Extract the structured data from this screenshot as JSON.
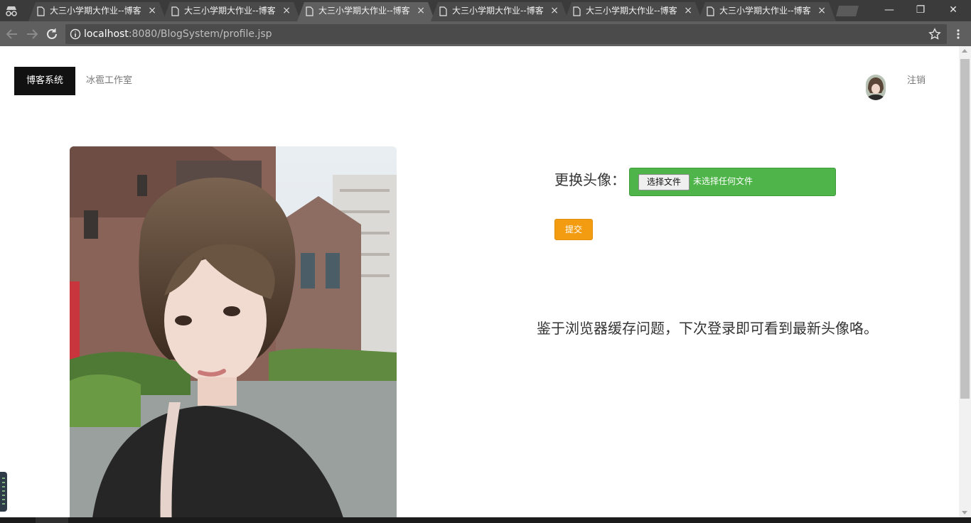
{
  "browser": {
    "tabs": [
      {
        "title": "大三小学期大作业--博客",
        "close": "×"
      },
      {
        "title": "大三小学期大作业--博客",
        "close": "×"
      },
      {
        "title": "大三小学期大作业--博客",
        "close": "×"
      },
      {
        "title": "大三小学期大作业--博客",
        "close": "×"
      },
      {
        "title": "大三小学期大作业--博客",
        "close": "×"
      },
      {
        "title": "大三小学期大作业--博客",
        "close": "×"
      }
    ],
    "active_tab_index": 2,
    "window_controls": {
      "minimize": "—",
      "restore": "❐",
      "close": "✕"
    },
    "url": {
      "host": "localhost",
      "rest": ":8080/BlogSystem/profile.jsp"
    }
  },
  "nav": {
    "brand": "博客系统",
    "studio": "冰雹工作室",
    "logout": "注销"
  },
  "form": {
    "label": "更换头像：",
    "file_button": "选择文件",
    "file_status": "未选择任何文件",
    "submit": "提交"
  },
  "notice": "鉴于浏览器缓存问题，下次登录即可看到最新头像咯。",
  "colors": {
    "tabstrip": "#3b3b3b",
    "toolbar": "#5f5f5f",
    "brand_bg": "#111111",
    "file_green": "#4fb54a",
    "submit_orange": "#f39c12"
  }
}
